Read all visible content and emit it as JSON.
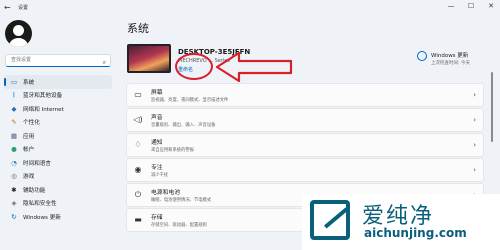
{
  "window": {
    "title": "设置",
    "back_glyph": "←",
    "minimize_glyph": "—",
    "maximize_glyph": "☐",
    "close_glyph": "✕"
  },
  "sidebar": {
    "search_placeholder": "查找设置",
    "items": [
      {
        "label": "系统",
        "icon": "monitor-icon",
        "glyph": "▭",
        "color": "#0067c0",
        "active": true
      },
      {
        "label": "蓝牙和其他设备",
        "icon": "bluetooth-icon",
        "glyph": "ᛒ",
        "color": "#0067c0",
        "active": false
      },
      {
        "label": "网络和 Internet",
        "icon": "wifi-icon",
        "glyph": "◆",
        "color": "#2b6cb0",
        "active": false
      },
      {
        "label": "个性化",
        "icon": "brush-icon",
        "glyph": "✎",
        "color": "#c06a1b",
        "active": false
      },
      {
        "label": "应用",
        "icon": "apps-icon",
        "glyph": "▦",
        "color": "#5a5a7a",
        "active": false
      },
      {
        "label": "帐户",
        "icon": "person-icon",
        "glyph": "●",
        "color": "#2aa26b",
        "active": false
      },
      {
        "label": "时间和语言",
        "icon": "clock-globe-icon",
        "glyph": "◔",
        "color": "#1e7fc9",
        "active": false
      },
      {
        "label": "游戏",
        "icon": "gamepad-icon",
        "glyph": "◎",
        "color": "#555555",
        "active": false
      },
      {
        "label": "辅助功能",
        "icon": "accessibility-icon",
        "glyph": "✱",
        "color": "#1a1a1a",
        "active": false
      },
      {
        "label": "隐私和安全性",
        "icon": "shield-icon",
        "glyph": "◈",
        "color": "#666666",
        "active": false
      },
      {
        "label": "Windows 更新",
        "icon": "update-icon",
        "glyph": "↻",
        "color": "#0067c0",
        "active": false
      }
    ]
  },
  "main": {
    "title": "系统",
    "device": {
      "name": "DESKTOP-3E5JFFN",
      "model": "MECHREVO ... Series",
      "rename_label": "重命名"
    },
    "windows_update": {
      "title": "Windows 更新",
      "status": "上次检查时间: 今天"
    },
    "cards": [
      {
        "title": "屏幕",
        "subtitle": "监视器、亮度、夜间模式、显示描述文件",
        "icon": "display-icon",
        "glyph": "▭"
      },
      {
        "title": "声音",
        "subtitle": "音量级别、输出、输入、声音设备",
        "icon": "speaker-icon",
        "glyph": "◁)"
      },
      {
        "title": "通知",
        "subtitle": "来自应用和系统的警报",
        "icon": "bell-icon",
        "glyph": "♢"
      },
      {
        "title": "专注",
        "subtitle": "减少干扰",
        "icon": "focus-icon",
        "glyph": "◉"
      },
      {
        "title": "电源和电池",
        "subtitle": "睡眠、电池使用情况、节电模式",
        "icon": "power-icon",
        "glyph": "⏻"
      },
      {
        "title": "存储",
        "subtitle": "存储空间、驱动器、配置规则",
        "icon": "storage-icon",
        "glyph": "▬"
      }
    ],
    "chevron_glyph": "›"
  },
  "watermark": {
    "text_cn": "爱纯净",
    "url": "aichunjing.com"
  },
  "colors": {
    "accent": "#0067c0",
    "annotation_red": "#d8202c",
    "watermark": "#0a5f7a",
    "background": "#eff3f8"
  }
}
